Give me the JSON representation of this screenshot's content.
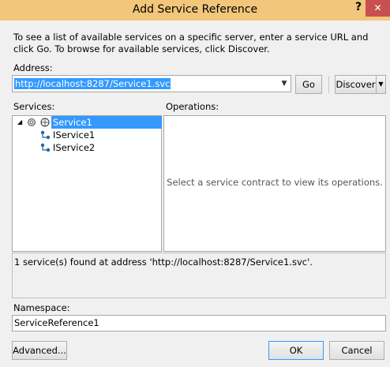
{
  "window": {
    "title": "Add Service Reference",
    "help_symbol": "?",
    "close_symbol": "✕"
  },
  "instructions": "To see a list of available services on a specific server, enter a service URL and click Go. To browse for available services, click Discover.",
  "address": {
    "label": "Address:",
    "value": "http://localhost:8287/Service1.svc"
  },
  "buttons": {
    "go": "Go",
    "discover": "Discover",
    "advanced": "Advanced...",
    "ok": "OK",
    "cancel": "Cancel"
  },
  "services": {
    "label": "Services:",
    "tree": {
      "root": "Service1",
      "children": [
        "IService1",
        "IService2"
      ]
    }
  },
  "operations": {
    "label": "Operations:",
    "placeholder": "Select a service contract to view its operations."
  },
  "status": "1 service(s) found at address 'http://localhost:8287/Service1.svc'.",
  "namespace": {
    "label": "Namespace:",
    "value": "ServiceReference1"
  },
  "colors": {
    "titlebar": "#f2c67b",
    "close": "#c75050",
    "selection": "#3399ff"
  }
}
